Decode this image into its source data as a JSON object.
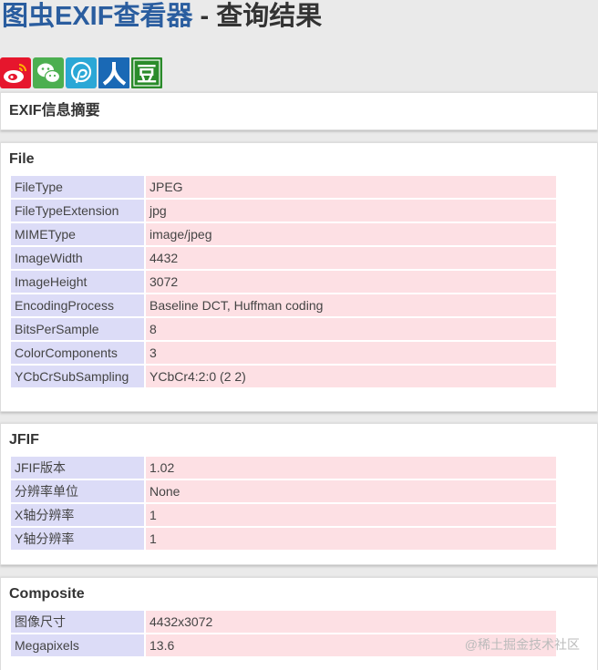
{
  "header": {
    "brand": "图虫EXIF查看器",
    "separator": " - ",
    "suffix": "查询结果"
  },
  "share": [
    {
      "name": "weibo",
      "icon": "weibo-icon",
      "color": "#e6162d"
    },
    {
      "name": "wechat",
      "icon": "wechat-icon",
      "color": "#4caf50"
    },
    {
      "name": "pengyou",
      "icon": "pengyou-icon",
      "color": "#2aa7d6"
    },
    {
      "name": "renren",
      "icon": "renren-icon",
      "color": "#1a69b5"
    },
    {
      "name": "douban",
      "icon": "douban-icon",
      "color": "#2a8b2a",
      "glyph": "豆"
    }
  ],
  "summary": {
    "title": "EXIF信息摘要"
  },
  "sections": [
    {
      "title": "File",
      "rows": [
        {
          "key": "FileType",
          "value": "JPEG"
        },
        {
          "key": "FileTypeExtension",
          "value": "jpg"
        },
        {
          "key": "MIMEType",
          "value": "image/jpeg"
        },
        {
          "key": "ImageWidth",
          "value": "4432"
        },
        {
          "key": "ImageHeight",
          "value": "3072"
        },
        {
          "key": "EncodingProcess",
          "value": "Baseline DCT, Huffman coding"
        },
        {
          "key": "BitsPerSample",
          "value": "8"
        },
        {
          "key": "ColorComponents",
          "value": "3"
        },
        {
          "key": "YCbCrSubSampling",
          "value": "YCbCr4:2:0 (2 2)"
        }
      ]
    },
    {
      "title": "JFIF",
      "rows": [
        {
          "key": "JFIF版本",
          "value": "1.02"
        },
        {
          "key": "分辨率单位",
          "value": "None"
        },
        {
          "key": "X轴分辨率",
          "value": "1"
        },
        {
          "key": "Y轴分辨率",
          "value": "1"
        }
      ]
    },
    {
      "title": "Composite",
      "rows": [
        {
          "key": "图像尺寸",
          "value": "4432x3072"
        },
        {
          "key": "Megapixels",
          "value": "13.6"
        }
      ]
    }
  ],
  "watermark": "@稀土掘金技术社区"
}
